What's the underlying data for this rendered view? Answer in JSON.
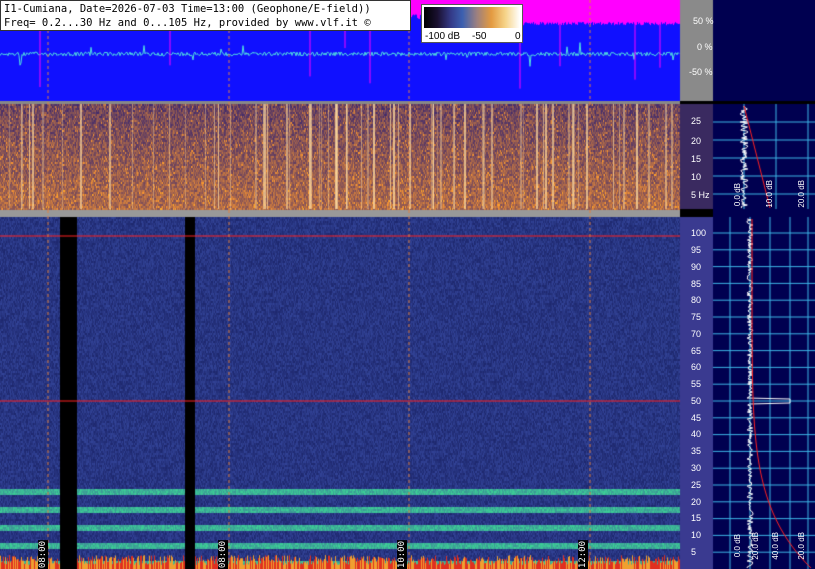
{
  "header": {
    "line1": "I1-Cumiana, Date=2026-07-03 Time=13:00 (Geophone/E-field))",
    "line2": "Freq= 0.2...30 Hz and 0...105 Hz, provided by www.vlf.it ©"
  },
  "colorbar": {
    "labels": [
      "-100 dB",
      "-50",
      "0"
    ]
  },
  "waveform": {
    "ticks": [
      "50 %",
      "0 %",
      "-50 %"
    ]
  },
  "elf_panel": {
    "ticks": [
      "25",
      "20",
      "15",
      "10",
      "5 Hz"
    ]
  },
  "vlf_panel": {
    "ticks": [
      "100",
      "95",
      "90",
      "85",
      "80",
      "75",
      "70",
      "65",
      "60",
      "55",
      "50",
      "45",
      "40",
      "35",
      "30",
      "25",
      "20",
      "15",
      "10",
      "5"
    ]
  },
  "time_labels": [
    "08:00",
    "08:00",
    "10:00",
    "12:00"
  ],
  "spectrum_top_labels": [
    "0.0 dB",
    "10.0 dB",
    "20.0 dB"
  ],
  "spectrum_bottom_labels": [
    "0.0 dB",
    "20.0 dB",
    "40.0 dB",
    "20.0 dB"
  ],
  "colors": {
    "waveform_bg": "#1010ff",
    "magenta": "#ff00ff",
    "panel_bg": "#3a2a60",
    "right_bg": "#000050",
    "grid": "#3db7e8",
    "redline": "#ff2020"
  }
}
